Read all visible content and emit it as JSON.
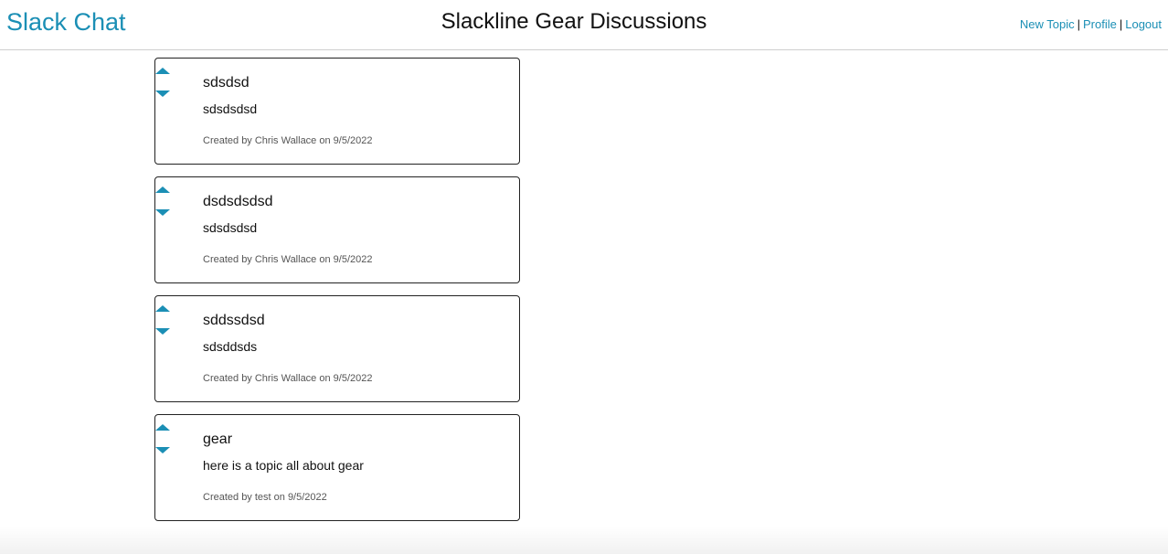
{
  "header": {
    "brand": "Slack Chat",
    "title": "Slackline Gear Discussions",
    "nav": {
      "new_topic": "New Topic",
      "profile": "Profile",
      "logout": "Logout",
      "separator": "|"
    }
  },
  "colors": {
    "accent": "#1b8fb5",
    "card_border": "#222222",
    "meta_text": "#555555"
  },
  "icons": {
    "upvote": "triangle-up-icon",
    "downvote": "triangle-down-icon"
  },
  "topics": [
    {
      "title": "sdsdsd",
      "body": "sdsdsdsd",
      "meta": "Created by Chris Wallace on 9/5/2022"
    },
    {
      "title": "dsdsdsdsd",
      "body": "sdsdsdsd",
      "meta": "Created by Chris Wallace on 9/5/2022"
    },
    {
      "title": "sddssdsd",
      "body": "sdsddsds",
      "meta": "Created by Chris Wallace on 9/5/2022"
    },
    {
      "title": "gear",
      "body": "here is a topic all about gear",
      "meta": "Created by test on 9/5/2022"
    }
  ]
}
